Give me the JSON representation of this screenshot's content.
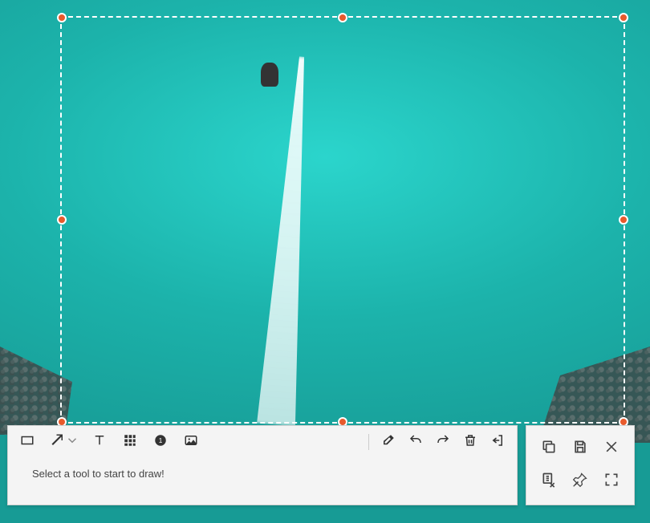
{
  "hint": "Select a tool to start to draw!",
  "tools": {
    "rectangle": "rectangle-tool",
    "arrow": "arrow-tool",
    "text": "text-tool",
    "mosaic": "mosaic-tool",
    "counter": "counter-tool",
    "image": "image-tool"
  },
  "edit_tools": {
    "eraser": "eraser-tool",
    "undo": "undo",
    "redo": "redo",
    "delete": "delete",
    "exit": "exit"
  },
  "actions": {
    "copy": "copy",
    "save": "save",
    "close": "close",
    "edit": "edit-tool",
    "pin": "pin",
    "fullscreen": "fullscreen"
  },
  "selection": {
    "handles": [
      "top-left",
      "top-mid",
      "top-right",
      "mid-left",
      "mid-right",
      "bottom-left",
      "bottom-mid",
      "bottom-right"
    ],
    "handle_color": "#e85a2c",
    "border_style": "dashed"
  }
}
